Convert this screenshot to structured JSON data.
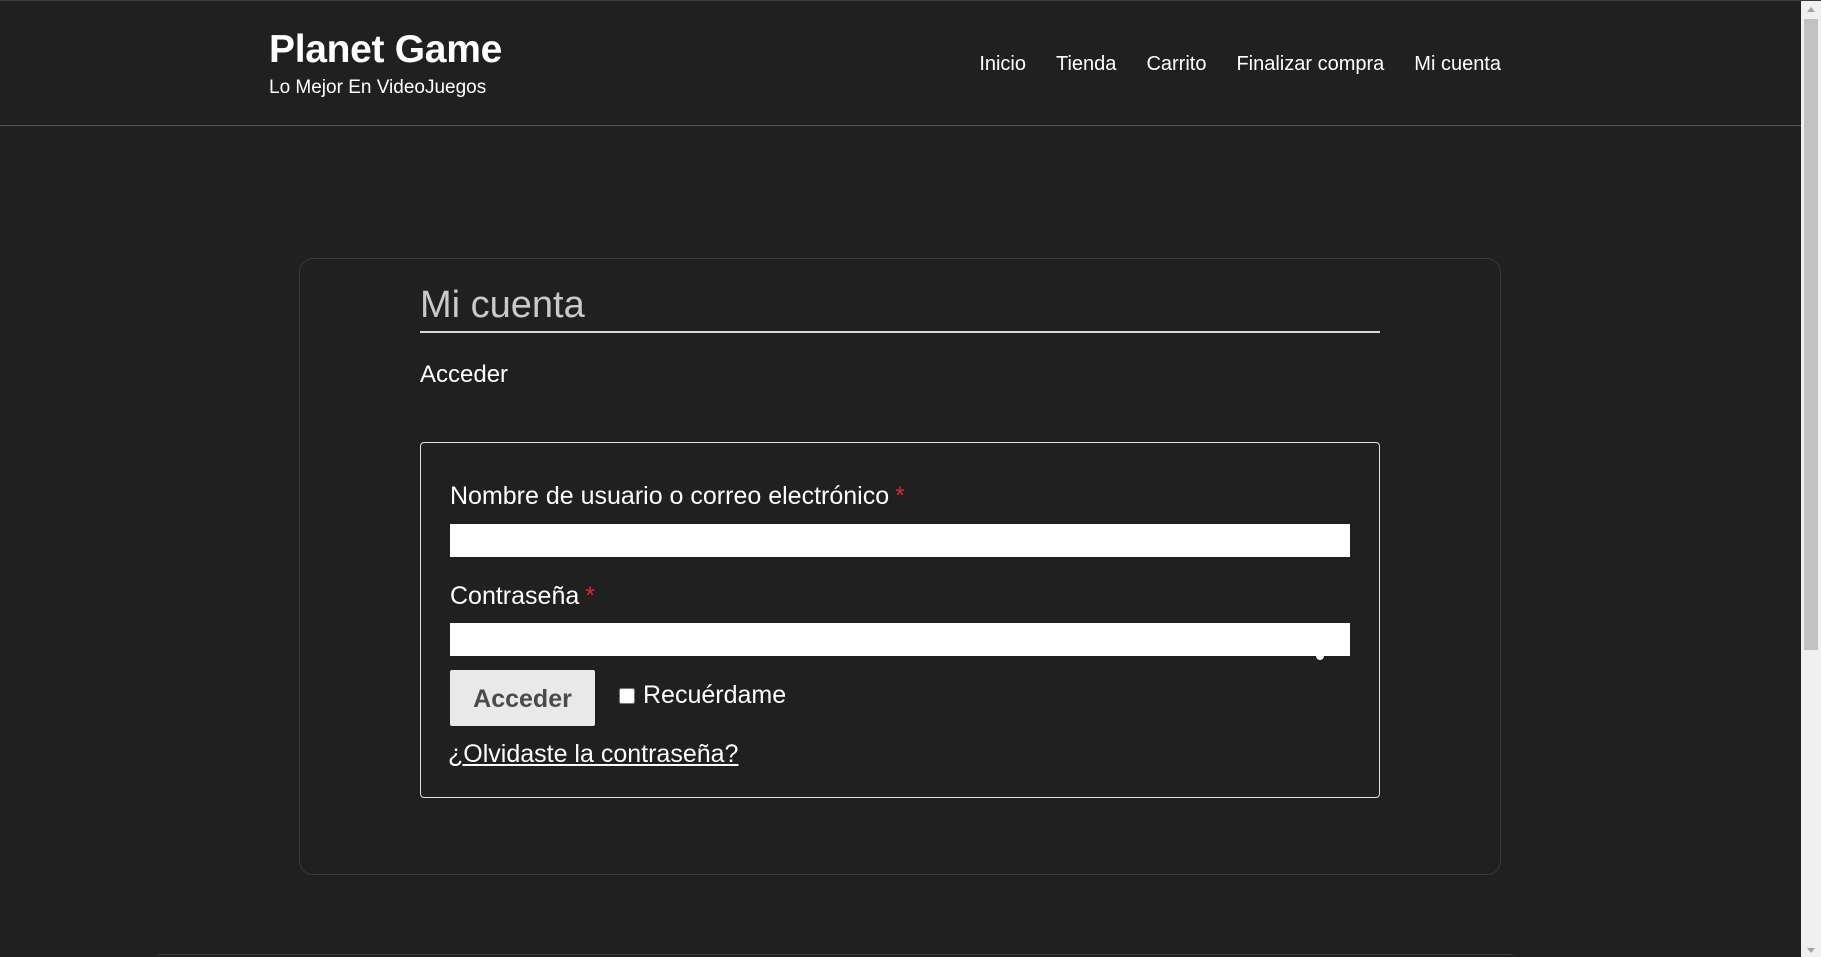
{
  "site": {
    "title": "Planet Game",
    "tagline": "Lo Mejor En VideoJuegos"
  },
  "nav": {
    "items": [
      {
        "label": "Inicio"
      },
      {
        "label": "Tienda"
      },
      {
        "label": "Carrito"
      },
      {
        "label": "Finalizar compra"
      },
      {
        "label": "Mi cuenta"
      }
    ]
  },
  "main": {
    "heading": "Mi cuenta",
    "section_title": "Acceder"
  },
  "login_form": {
    "username_label": "Nombre de usuario o correo electrónico",
    "username_value": "",
    "password_label": "Contraseña",
    "password_value": "",
    "required_marker": "*",
    "submit_label": "Acceder",
    "remember_label": "Recuérdame",
    "remember_checked": false,
    "lost_password_label": "¿Olvidaste la contraseña?"
  },
  "icons": {
    "password_toggle": "eye-icon"
  },
  "colors": {
    "background": "#202020",
    "text": "#ffffff",
    "heading_text": "#c9c9c9",
    "required": "#e0262b",
    "button_bg": "#e9e9ea",
    "button_text": "#4a4a4a"
  }
}
